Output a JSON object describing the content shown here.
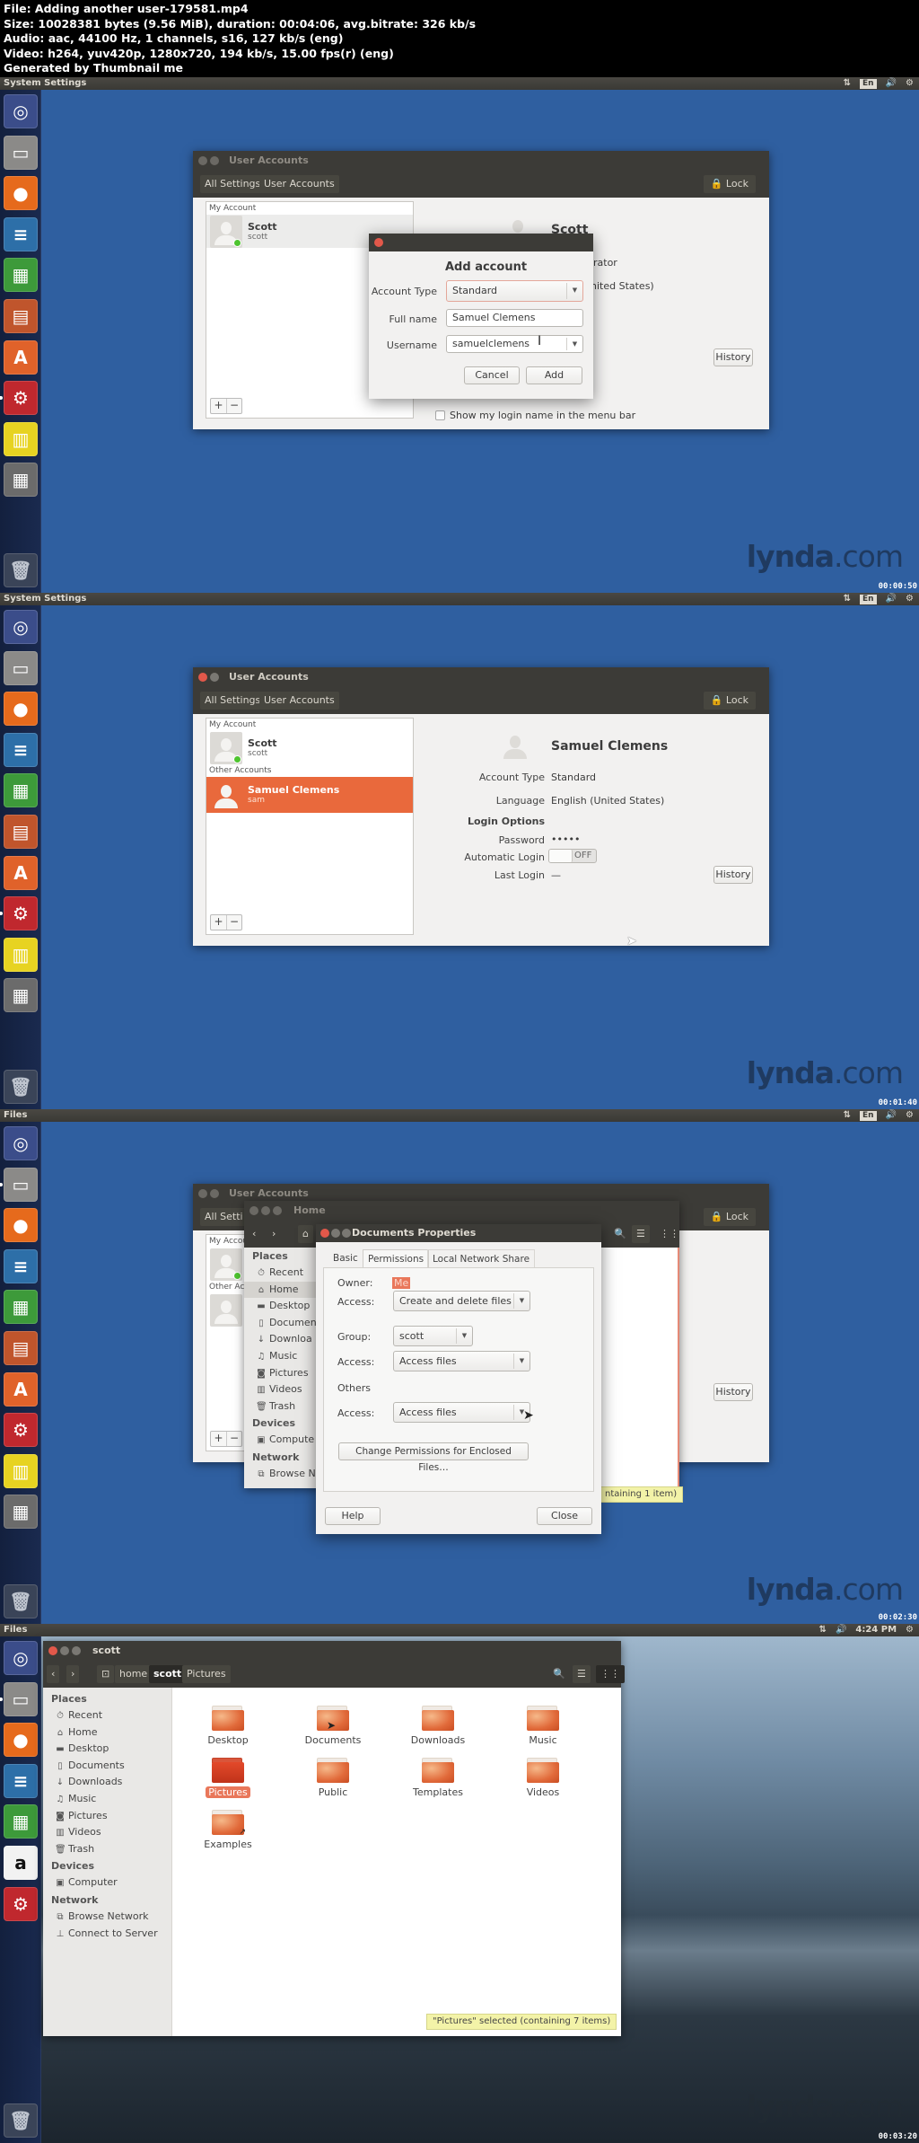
{
  "header": {
    "line1": "File: Adding another user-179581.mp4",
    "line2": "Size: 10028381 bytes (9.56 MiB), duration: 00:04:06, avg.bitrate: 326 kb/s",
    "line3": "Audio: aac, 44100 Hz, 1 channels, s16, 127 kb/s (eng)",
    "line4": "Video: h264, yuv420p, 1280x720, 194 kb/s, 15.00 fps(r) (eng)",
    "line5": "Generated by Thumbnail me"
  },
  "tray": {
    "network_icon": "⇅",
    "keyboard": "En",
    "volume_icon": "🔊",
    "gear_icon": "⚙",
    "clock": "4:24 PM"
  },
  "watermark": {
    "brand": "lynda",
    "tld": ".com"
  },
  "launcher": {
    "items_a": [
      {
        "name": "dash",
        "glyph": "◎",
        "bg": "#3b4d8a"
      },
      {
        "name": "files",
        "glyph": "▭",
        "bg": "#8b8a88"
      },
      {
        "name": "firefox",
        "glyph": "●",
        "bg": "#e66a1c"
      },
      {
        "name": "writer",
        "glyph": "≡",
        "bg": "#2d6fa8"
      },
      {
        "name": "calc",
        "glyph": "▦",
        "bg": "#3d9a3a"
      },
      {
        "name": "impress",
        "glyph": "▤",
        "bg": "#c0552c"
      },
      {
        "name": "software-center",
        "glyph": "A",
        "bg": "#e0622a"
      },
      {
        "name": "system-settings",
        "glyph": "⚙",
        "bg": "#c0282e"
      },
      {
        "name": "workspaces",
        "glyph": "▥",
        "bg": "#e7d321"
      },
      {
        "name": "calculator",
        "glyph": "▦",
        "bg": "#6b6b6b"
      }
    ],
    "items_b": [
      {
        "name": "dash",
        "glyph": "◎",
        "bg": "#3b4d8a"
      },
      {
        "name": "files",
        "glyph": "▭",
        "bg": "#8b8a88"
      },
      {
        "name": "firefox",
        "glyph": "●",
        "bg": "#e66a1c"
      },
      {
        "name": "writer",
        "glyph": "≡",
        "bg": "#2d6fa8"
      },
      {
        "name": "calc",
        "glyph": "▦",
        "bg": "#3d9a3a"
      },
      {
        "name": "amazon",
        "glyph": "a",
        "bg": "#f2f2f2"
      },
      {
        "name": "system-settings",
        "glyph": "⚙",
        "bg": "#c0282e"
      }
    ],
    "trash_glyph": "🗑"
  },
  "panel1": {
    "app_title": "System Settings",
    "timestamp": "00:00:50",
    "window": {
      "title": "User Accounts",
      "crumbs": [
        "All Settings",
        "User Accounts"
      ],
      "lock_label": "Lock",
      "my_account_header": "My Account",
      "user": {
        "name": "Scott",
        "login": "scott"
      },
      "right_name": "Scott",
      "right_type_partial": "rator",
      "right_lang_partial": "nited States)",
      "history": "History",
      "show_login_label": "Show my login name in the menu bar"
    },
    "dialog": {
      "title": "Add account",
      "account_type_label": "Account Type",
      "account_type_value": "Standard",
      "full_name_label": "Full name",
      "full_name_value": "Samuel Clemens",
      "username_label": "Username",
      "username_value": "samuelclemens",
      "cancel": "Cancel",
      "add": "Add"
    }
  },
  "panel2": {
    "app_title": "System Settings",
    "timestamp": "00:01:40",
    "window": {
      "title": "User Accounts",
      "crumbs": [
        "All Settings",
        "User Accounts"
      ],
      "lock_label": "Lock",
      "my_account_header": "My Account",
      "other_accounts_header": "Other Accounts",
      "users": [
        {
          "name": "Scott",
          "login": "scott"
        },
        {
          "name": "Samuel Clemens",
          "login": "sam"
        }
      ],
      "detail": {
        "name": "Samuel Clemens",
        "account_type_label": "Account Type",
        "account_type": "Standard",
        "language_label": "Language",
        "language": "English (United States)",
        "login_options": "Login Options",
        "password_label": "Password",
        "password": "•••••",
        "auto_login_label": "Automatic Login",
        "auto_login": "OFF",
        "last_login_label": "Last Login",
        "last_login": "—",
        "history": "History"
      }
    }
  },
  "panel3": {
    "app_title": "Files",
    "timestamp": "00:02:30",
    "bg_window": {
      "title": "User Accounts",
      "crumb": "All Setti",
      "lock_label": "Lock",
      "my_account": "My Accou",
      "other_accounts": "Other Ac",
      "history": "History"
    },
    "home_window": {
      "title": "Home",
      "places": "Places",
      "items": [
        "Recent",
        "Home",
        "Desktop",
        "Documen",
        "Downloa",
        "Music",
        "Pictures",
        "Videos",
        "Trash"
      ],
      "devices": "Devices",
      "device_items": [
        "Compute"
      ],
      "network": "Network",
      "network_items": [
        "Browse N"
      ],
      "status_partial": "ntaining 1 item)"
    },
    "dialog": {
      "title": "Documents Properties",
      "tabs": [
        "Basic",
        "Permissions",
        "Local Network Share"
      ],
      "owner_label": "Owner:",
      "owner_value": "Me",
      "access_label": "Access:",
      "owner_access": "Create and delete files",
      "group_label": "Group:",
      "group_value": "scott",
      "group_access": "Access files",
      "others_label": "Others",
      "others_access": "Access files",
      "enclosed_button": "Change Permissions for Enclosed Files…",
      "help": "Help",
      "close": "Close"
    }
  },
  "panel4": {
    "app_title": "Files",
    "timestamp": "00:03:20",
    "window": {
      "title": "scott",
      "crumbs": [
        "home",
        "scott",
        "Pictures"
      ],
      "places": "Places",
      "places_items": [
        {
          "icon": "⏱",
          "label": "Recent"
        },
        {
          "icon": "⌂",
          "label": "Home"
        },
        {
          "icon": "▬",
          "label": "Desktop"
        },
        {
          "icon": "▯",
          "label": "Documents"
        },
        {
          "icon": "↓",
          "label": "Downloads"
        },
        {
          "icon": "♫",
          "label": "Music"
        },
        {
          "icon": "◙",
          "label": "Pictures"
        },
        {
          "icon": "▥",
          "label": "Videos"
        },
        {
          "icon": "🗑",
          "label": "Trash"
        }
      ],
      "devices": "Devices",
      "device_items": [
        {
          "icon": "▣",
          "label": "Computer"
        }
      ],
      "network": "Network",
      "network_items": [
        {
          "icon": "⧉",
          "label": "Browse Network"
        },
        {
          "icon": "⊥",
          "label": "Connect to Server"
        }
      ],
      "folders": [
        "Desktop",
        "Documents",
        "Downloads",
        "Music",
        "Pictures",
        "Public",
        "Templates",
        "Videos",
        "Examples"
      ],
      "selected_folder": "Pictures",
      "status": "\"Pictures\" selected  (containing 7 items)"
    }
  }
}
